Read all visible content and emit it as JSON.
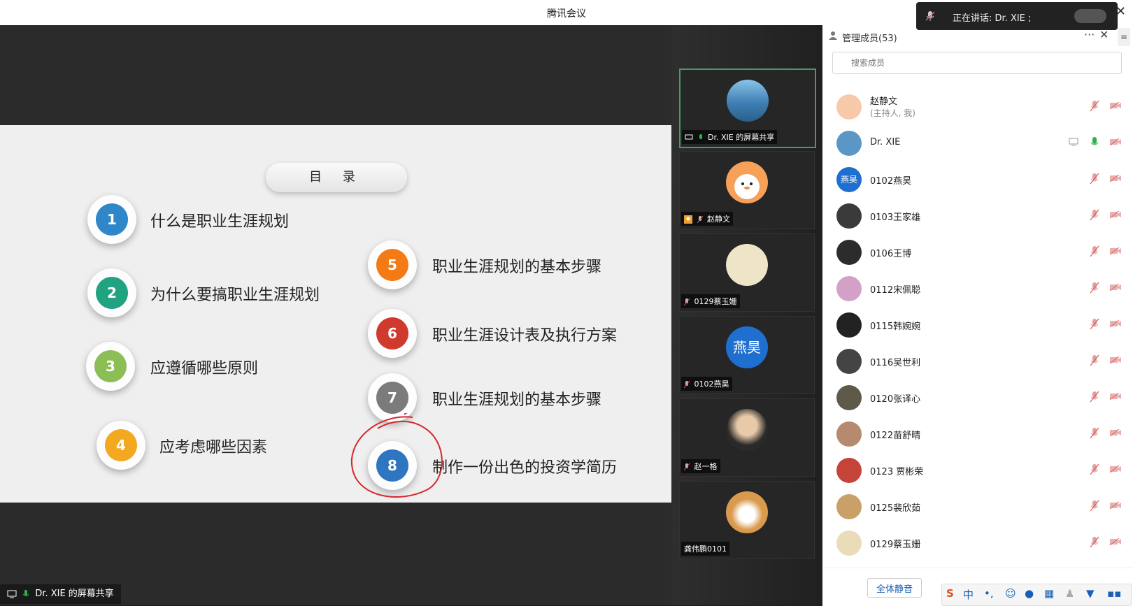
{
  "window": {
    "title": "腾讯会议",
    "close": "✕"
  },
  "speaking": {
    "text": "正在讲话: Dr. XIE ;"
  },
  "slide": {
    "title": "目 录",
    "items": [
      {
        "num": "1",
        "label": "什么是职业生涯规划",
        "color": "#2f86c8"
      },
      {
        "num": "2",
        "label": "为什么要搞职业生涯规划",
        "color": "#21a382"
      },
      {
        "num": "3",
        "label": "应遵循哪些原则",
        "color": "#8cbe56"
      },
      {
        "num": "4",
        "label": "应考虑哪些因素",
        "color": "#f2a81f"
      },
      {
        "num": "5",
        "label": "职业生涯规划的基本步骤",
        "color": "#f47a16"
      },
      {
        "num": "6",
        "label": "职业生涯设计表及执行方案",
        "color": "#cf3a2c"
      },
      {
        "num": "7",
        "label": "职业生涯规划的基本步骤",
        "color": "#7b7b7b"
      },
      {
        "num": "8",
        "label": "制作一份出色的投资学简历",
        "color": "#2f76c0"
      }
    ]
  },
  "share_tag": "Dr. XIE 的屏幕共享",
  "videos": [
    {
      "name": "Dr. XIE 的屏幕共享",
      "avatar": "sea"
    },
    {
      "name": "赵静文",
      "avatar": "chick"
    },
    {
      "name": "0129蔡玉姗",
      "avatar": "anime"
    },
    {
      "name": "0102燕昊",
      "avatar": "text",
      "avatar_text": "燕昊"
    },
    {
      "name": "赵一格",
      "avatar": "girl"
    },
    {
      "name": "龚伟鹏0101",
      "avatar": "dog"
    }
  ],
  "panel": {
    "title": "管理成员(53)",
    "more": "···",
    "close": "✕",
    "menu": "≡",
    "search_placeholder": "搜索成员",
    "members": [
      {
        "name": "赵静文",
        "sub": "(主持人, 我)",
        "color": "#f7c9a8"
      },
      {
        "name": "Dr. XIE",
        "color": "#5a97c6"
      },
      {
        "name": "0102燕昊",
        "color": "#1f6fd0",
        "avatar_text": "燕昊"
      },
      {
        "name": "0103王家雄",
        "color": "#3a3a3a"
      },
      {
        "name": "0106王博",
        "color": "#2c2c2c"
      },
      {
        "name": "0112宋佩聪",
        "color": "#d3a0c8"
      },
      {
        "name": "0115韩婉婉",
        "color": "#222222"
      },
      {
        "name": "0116吴世利",
        "color": "#444444"
      },
      {
        "name": "0120张译心",
        "color": "#5d5a4a"
      },
      {
        "name": "0122苗舒晴",
        "color": "#b58a6e"
      },
      {
        "name": "0123 贾彬荣",
        "color": "#c5443a"
      },
      {
        "name": "0125裴欣茹",
        "color": "#c9a068"
      },
      {
        "name": "0129蔡玉姗",
        "color": "#eadcb8"
      }
    ],
    "btn_mute_all": "全体静音",
    "ime_text": "中"
  },
  "colors": {
    "accent": "#1a5fb4",
    "active_border": "#4a9a69",
    "mic_green": "#2fb24c",
    "mic_off": "#e08a8a"
  }
}
